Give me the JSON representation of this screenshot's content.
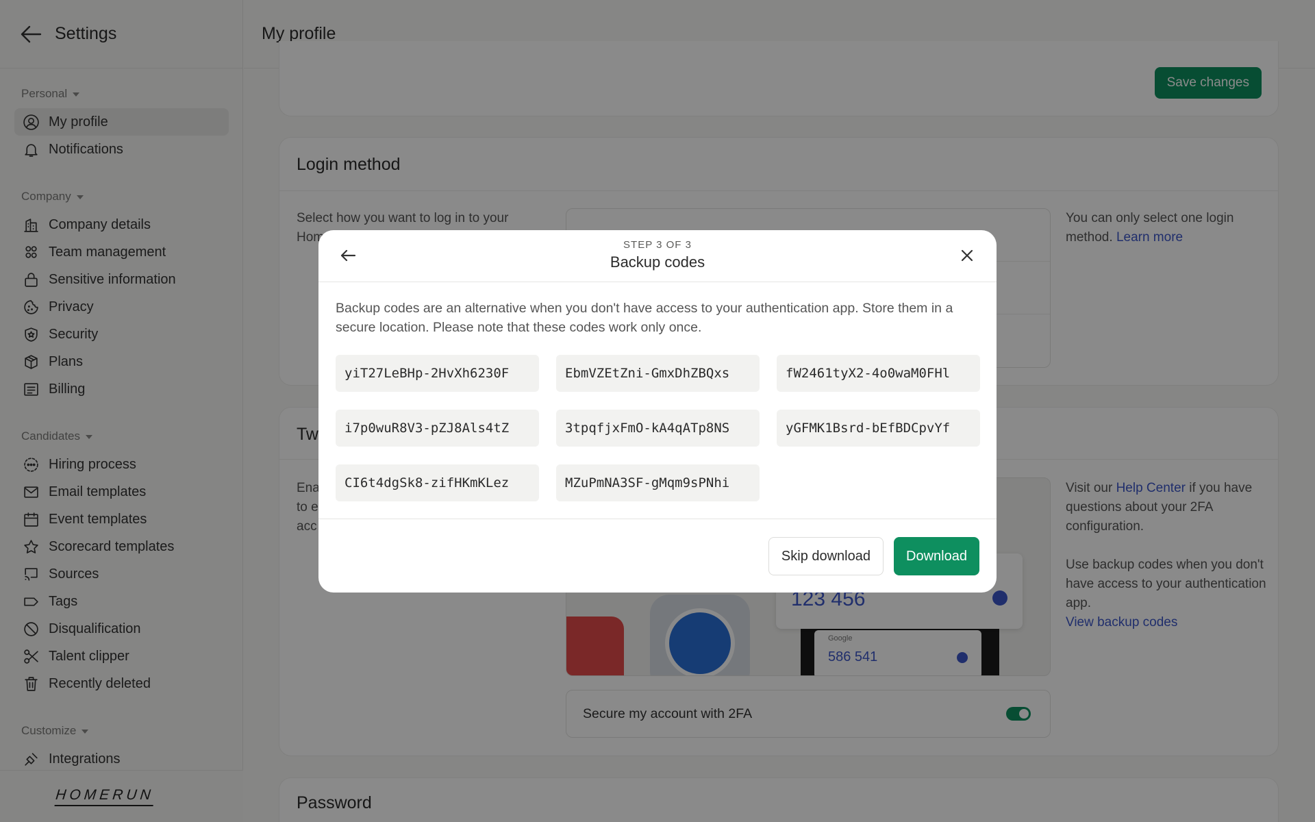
{
  "sidebar": {
    "title": "Settings",
    "sections": {
      "personal": "Personal",
      "company": "Company",
      "candidates": "Candidates",
      "customize": "Customize"
    },
    "items": {
      "my_profile": "My profile",
      "notifications": "Notifications",
      "company_details": "Company details",
      "team_management": "Team management",
      "sensitive_information": "Sensitive information",
      "privacy": "Privacy",
      "security": "Security",
      "plans": "Plans",
      "billing": "Billing",
      "hiring_process": "Hiring process",
      "email_templates": "Email templates",
      "event_templates": "Event templates",
      "scorecard_templates": "Scorecard templates",
      "sources": "Sources",
      "tags": "Tags",
      "disqualification": "Disqualification",
      "talent_clipper": "Talent clipper",
      "recently_deleted": "Recently deleted",
      "integrations_partial": "Integrations"
    },
    "logo": "HOMERUN"
  },
  "header": {
    "title": "My profile"
  },
  "profile_card": {
    "save_label": "Save changes"
  },
  "login_method": {
    "title": "Login method",
    "desc_partial_1": "Select how you want to log in to your",
    "desc_partial_2": "Hom",
    "note": "You can only select one login method.",
    "learn_more": "Learn more"
  },
  "two_fa": {
    "title_partial": "Tw",
    "desc_partial_1": "Ena",
    "desc_partial_2": "to e",
    "desc_partial_3": "acc",
    "help_prefix": "Visit our",
    "help_link": "Help Center",
    "help_suffix": "if you have questions about your 2FA configuration.",
    "backup_note": "Use backup codes when you don't have access to your authentication app.",
    "view_codes": "View backup codes",
    "toggle_label": "Secure my account with 2FA",
    "mock_code_1": "123 456",
    "mock_app": "Google",
    "mock_code_2": "586 541"
  },
  "password": {
    "title": "Password"
  },
  "modal": {
    "step": "STEP 3 OF 3",
    "title": "Backup codes",
    "description": "Backup codes are an alternative when you don't have access to your authentication app. Store them in a secure location. Please note that these codes work only once.",
    "codes": [
      "yiT27LeBHp-2HvXh6230F",
      "EbmVZEtZni-GmxDhZBQxs",
      "fW2461tyX2-4o0waM0FHl",
      "i7p0wuR8V3-pZJ8Als4tZ",
      "3tpqfjxFmO-kA4qATp8NS",
      "yGFMK1Bsrd-bEfBDCpvYf",
      "CI6t4dgSk8-zifHKmKLez",
      "MZuPmNA3SF-gMqm9sPNhi"
    ],
    "skip_label": "Skip download",
    "download_label": "Download"
  },
  "colors": {
    "accent": "#0e8f5f",
    "link": "#3b56c7"
  }
}
